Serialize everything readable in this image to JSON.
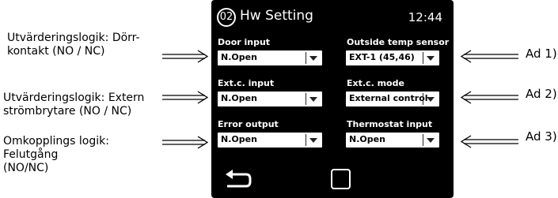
{
  "annotations": {
    "door_logic": [
      "Utvärderingslogik: Dörr-",
      "kontakt (NO / NC)"
    ],
    "ext_logic": [
      "Utvärderingslogik: Extern",
      "strömbrytare (NO / NC)"
    ],
    "error_logic": [
      "Omkopplings logik:",
      "Felutgång",
      "(NO/NC)"
    ],
    "ad1": "Ad 1)",
    "ad2": "Ad 2)",
    "ad3": "Ad 3)"
  },
  "header": {
    "number": "02",
    "title": "Hw Setting",
    "time": "12:44"
  },
  "fields": {
    "door_input": {
      "label": "Door input",
      "value": "N.Open"
    },
    "outside_temp_sensor": {
      "label": "Outside temp sensor",
      "value": "EXT-1 (45,46)"
    },
    "ext_input": {
      "label": "Ext.c. input",
      "value": "N.Open"
    },
    "ext_mode": {
      "label": "Ext.c. mode",
      "value": "External control"
    },
    "error_output": {
      "label": "Error output",
      "value": "N.Open"
    },
    "thermostat_input": {
      "label": "Thermostat input",
      "value": "N.Open"
    }
  },
  "nav": {
    "back_icon": "back-arrow-icon",
    "home_icon": "home-square-icon"
  },
  "colors": {
    "screen_bg": "#000000",
    "text": "#ffffff",
    "dropdown_bg": "#ffffff"
  }
}
